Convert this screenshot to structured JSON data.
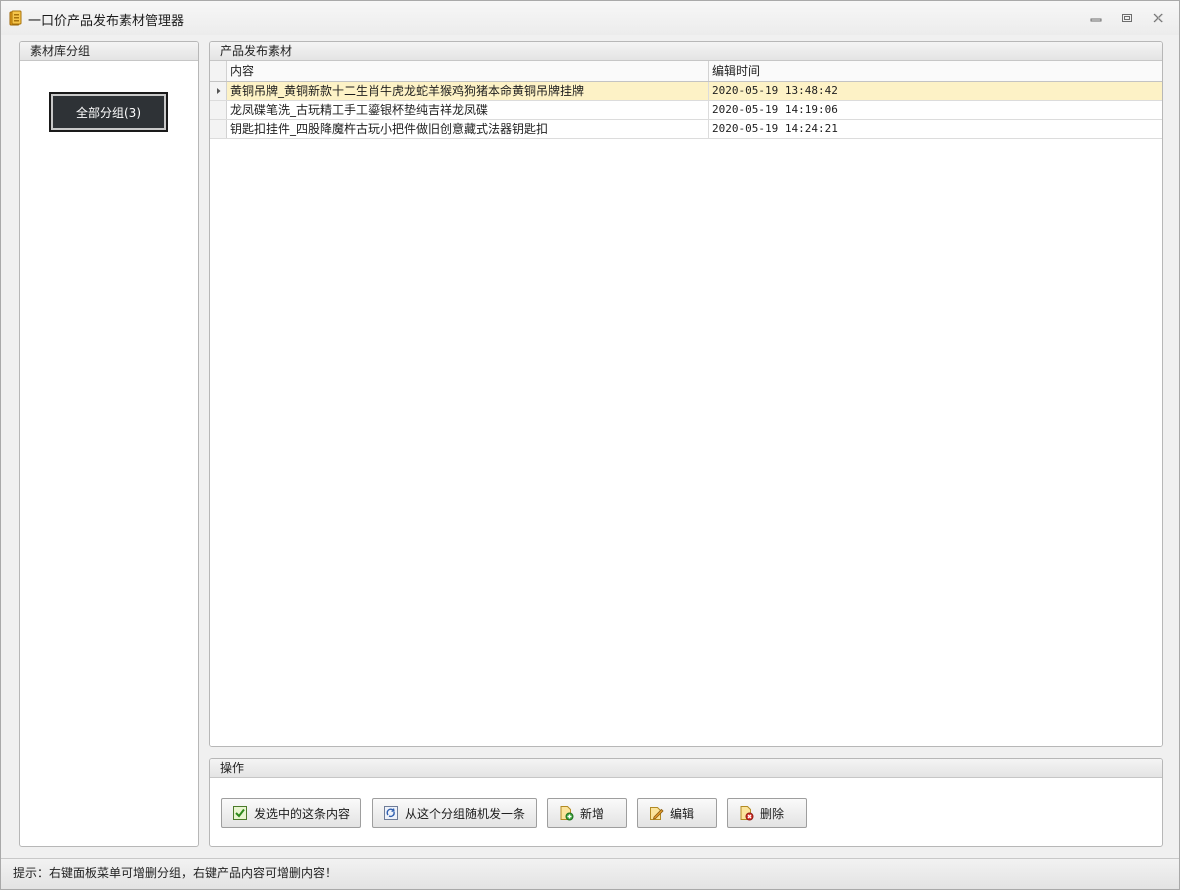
{
  "window": {
    "title": "一口价产品发布素材管理器",
    "controls": [
      "minimize-icon",
      "restore-icon",
      "close-icon"
    ]
  },
  "left_panel": {
    "title": "素材库分组",
    "groups": [
      {
        "label": "全部分组(3)",
        "selected": true
      }
    ]
  },
  "materials_panel": {
    "title": "产品发布素材",
    "columns": {
      "content": "内容",
      "edit_time": "编辑时间"
    },
    "rows": [
      {
        "content": "黄铜吊牌_黄铜新款十二生肖牛虎龙蛇羊猴鸡狗猪本命黄铜吊牌挂牌",
        "edit_time": "2020-05-19 13:48:42",
        "selected": true
      },
      {
        "content": "龙凤碟笔洗_古玩精工手工鎏银杯垫纯吉祥龙凤碟",
        "edit_time": "2020-05-19 14:19:06",
        "selected": false
      },
      {
        "content": "钥匙扣挂件_四股降魔杵古玩小把件做旧创意藏式法器钥匙扣",
        "edit_time": "2020-05-19 14:24:21",
        "selected": false
      }
    ]
  },
  "actions_panel": {
    "title": "操作",
    "buttons": {
      "send_selected": "发选中的这条内容",
      "send_random": "从这个分组随机发一条",
      "add": "新增",
      "edit": "编辑",
      "delete": "删除"
    }
  },
  "status_bar": {
    "text": "提示：右键面板菜单可增删分组，右键产品内容可增删内容！"
  },
  "colors": {
    "selected_row": "#fdf2c6",
    "group_button_bg": "#2e3236",
    "window_bg": "#f0f0f0"
  }
}
